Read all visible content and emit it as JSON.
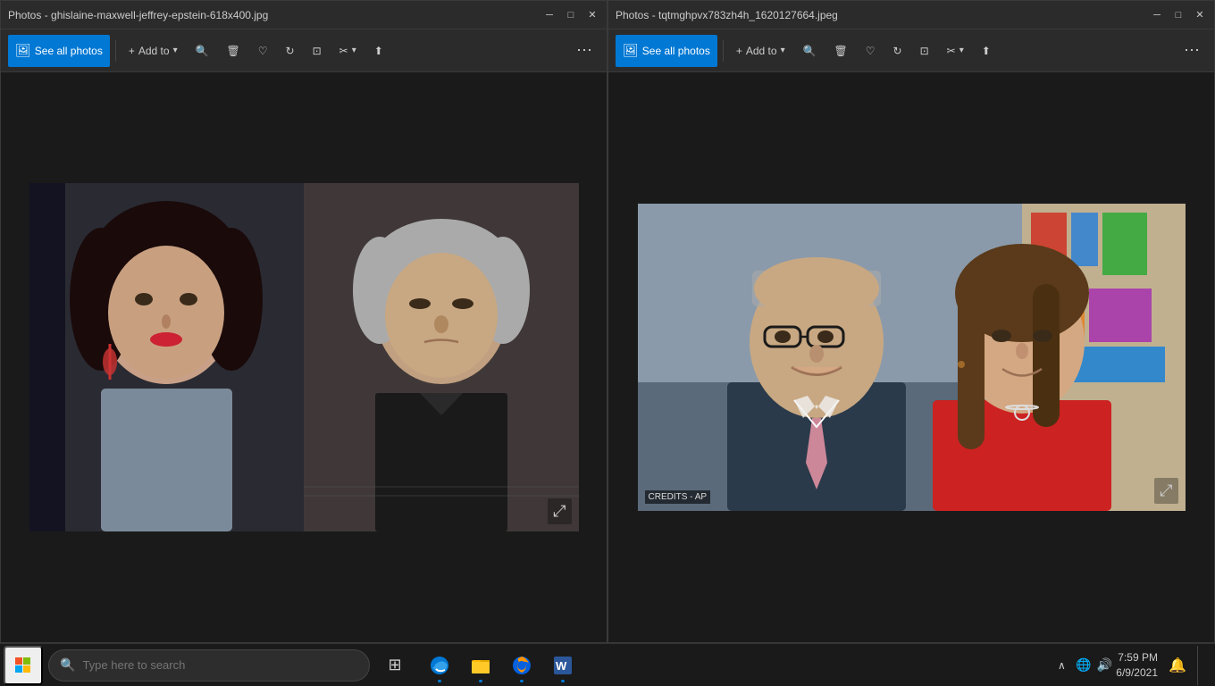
{
  "windows": {
    "left": {
      "title": "Photos - ghislaine-maxwell-jeffrey-epstein-618x400.jpg",
      "toolbar": {
        "see_all_photos": "See all photos",
        "add_to": "Add to",
        "zoom_in_icon": "🔍",
        "delete_icon": "🗑",
        "heart_icon": "♡",
        "rotate_icon": "↻",
        "crop_icon": "⬜",
        "edit_icon": "✂",
        "share_icon": "⬆",
        "more_icon": "⋯"
      }
    },
    "right": {
      "title": "Photos - tqtmghpvx783zh4h_1620127664.jpeg",
      "toolbar": {
        "see_all_photos": "See all photos",
        "add_to": "Add to",
        "zoom_in_icon": "🔍",
        "delete_icon": "🗑",
        "heart_icon": "♡",
        "rotate_icon": "↻",
        "crop_icon": "⬜",
        "edit_icon": "✂",
        "share_icon": "⬆",
        "more_icon": "⋯"
      },
      "credits": "CREDITS - AP"
    }
  },
  "taskbar": {
    "search_placeholder": "Type here to search",
    "time": "7:59 PM",
    "date": "6/9/2021",
    "apps": [
      {
        "name": "Task View",
        "icon": "⊞"
      },
      {
        "name": "Microsoft Edge",
        "icon": "edge"
      },
      {
        "name": "File Explorer",
        "icon": "📁"
      },
      {
        "name": "Firefox",
        "icon": "firefox"
      },
      {
        "name": "Word",
        "icon": "word"
      }
    ]
  }
}
